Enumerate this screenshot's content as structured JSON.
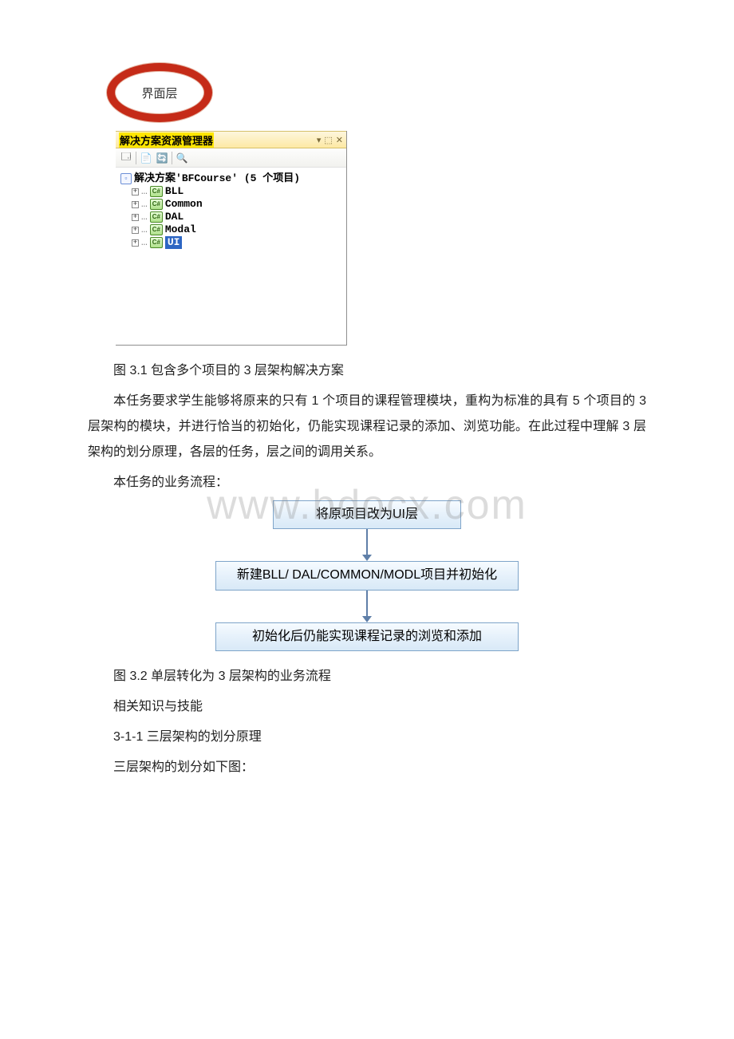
{
  "oval_label": "界面层",
  "panel": {
    "title": "解决方案资源管理器",
    "controls": {
      "dropdown": "▾",
      "pin": "⬚",
      "close": "✕"
    },
    "toolbar": [
      "🗔",
      "📄",
      "🔄",
      "🔍"
    ]
  },
  "tree": {
    "solution_prefix": "解决方案",
    "solution_name": "'BFCourse'",
    "solution_suffix": "(5 个项目)",
    "items": [
      {
        "name": "BLL",
        "selected": false
      },
      {
        "name": "Common",
        "selected": false
      },
      {
        "name": "DAL",
        "selected": false
      },
      {
        "name": "Modal",
        "selected": false
      },
      {
        "name": "UI",
        "selected": true
      }
    ],
    "cs_glyph": "C#",
    "plus": "+"
  },
  "caption1": "图 3.1 包含多个项目的 3 层架构解决方案",
  "para1": "本任务要求学生能够将原来的只有 1 个项目的课程管理模块，重构为标准的具有 5 个项目的 3 层架构的模块，并进行恰当的初始化，仍能实现课程记录的添加、浏览功能。在此过程中理解 3 层架构的划分原理，各层的任务，层之间的调用关系。",
  "para2": "本任务的业务流程：",
  "flow": {
    "step1": "将原项目改为UI层",
    "step2": "新建BLL/ DAL/COMMON/MODL项目并初始化",
    "step3": "初始化后仍能实现课程记录的浏览和添加"
  },
  "caption2": "图 3.2 单层转化为 3 层架构的业务流程",
  "h1": "相关知识与技能",
  "h2": "3-1-1 三层架构的划分原理",
  "h3": "三层架构的划分如下图：",
  "watermark": "www.bdocx.com"
}
